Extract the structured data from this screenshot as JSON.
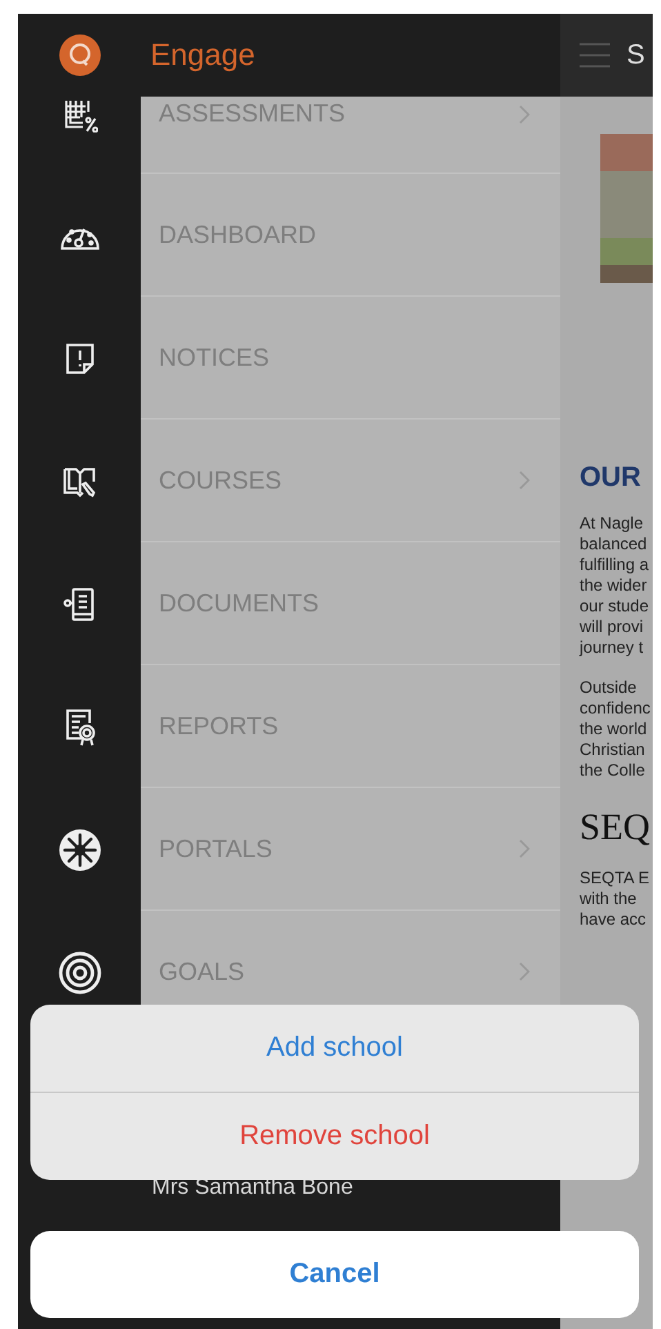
{
  "app": {
    "title": "Engage",
    "content_header": "S"
  },
  "menu": [
    {
      "label": "ASSESSMENTS",
      "expandable": true
    },
    {
      "label": "DASHBOARD",
      "expandable": false
    },
    {
      "label": "NOTICES",
      "expandable": false
    },
    {
      "label": "COURSES",
      "expandable": true
    },
    {
      "label": "DOCUMENTS",
      "expandable": false
    },
    {
      "label": "REPORTS",
      "expandable": false
    },
    {
      "label": "PORTALS",
      "expandable": true
    },
    {
      "label": "GOALS",
      "expandable": true
    }
  ],
  "user": {
    "name": "Mrs Samantha Bone"
  },
  "content": {
    "heading": "OUR",
    "paragraphs": [
      [
        "At Nagle",
        "balanced",
        "fulfilling a",
        "the wider",
        "our stude",
        "will provi",
        "journey t"
      ],
      [
        "Outside",
        "confidenc",
        "the world",
        "Christian",
        "the Colle"
      ]
    ],
    "subheading": "SEQ",
    "paragraphs_2": [
      [
        "SEQTA E",
        "with the",
        "have acc"
      ]
    ]
  },
  "action_sheet": {
    "actions": [
      {
        "label": "Add school",
        "kind": "default"
      },
      {
        "label": "Remove school",
        "kind": "destructive"
      }
    ],
    "cancel": "Cancel"
  }
}
